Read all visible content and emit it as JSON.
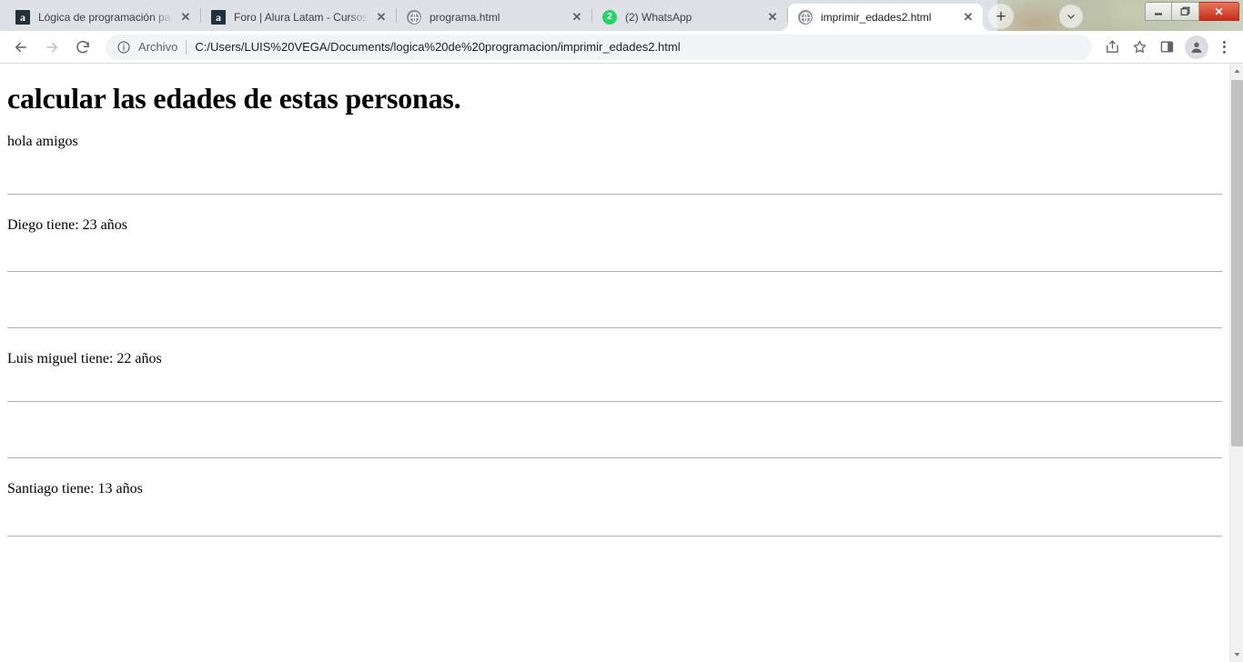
{
  "window": {
    "controls": {
      "minimize_label": "—",
      "maximize_label": "❐",
      "close_label": "✕"
    }
  },
  "tabstrip": {
    "tabs": [
      {
        "title": "Lógica de programación parte",
        "favicon": "alura-a-icon",
        "close_label": "✕",
        "active": false
      },
      {
        "title": "Foro | Alura Latam - Cursos on",
        "favicon": "alura-a-icon",
        "close_label": "✕",
        "active": false
      },
      {
        "title": "programa.html",
        "favicon": "globe-icon",
        "close_label": "✕",
        "active": false
      },
      {
        "title": "(2) WhatsApp",
        "favicon": "whatsapp-icon",
        "badge": "2",
        "close_label": "✕",
        "active": false
      },
      {
        "title": "imprimir_edades2.html",
        "favicon": "globe-icon",
        "close_label": "✕",
        "active": true
      }
    ],
    "new_tab_label": "+",
    "tab_search_label": "⌄"
  },
  "toolbar": {
    "back_label": "←",
    "forward_label": "→",
    "reload_label": "⟳",
    "omnibox": {
      "scheme_label": "Archivo",
      "url": "C:/Users/LUIS%20VEGA/Documents/logica%20de%20programacion/imprimir_edades2.html",
      "info_icon": "info-circle-icon"
    },
    "share_icon": "share-icon",
    "bookmark_icon": "star-icon",
    "side_panel_icon": "side-panel-icon",
    "profile_icon": "person-avatar-icon",
    "menu_icon": "three-dot-menu-icon"
  },
  "page": {
    "heading": "calcular las edades de estas personas.",
    "greeting": "hola amigos",
    "entries": [
      {
        "text": "Diego tiene: 23 años",
        "name": "Diego",
        "age": 23
      },
      {
        "text": "",
        "name": "",
        "age": null
      },
      {
        "text": "Luis miguel tiene: 22 años",
        "name": "Luis miguel",
        "age": 22
      },
      {
        "text": "",
        "name": "",
        "age": null
      },
      {
        "text": "Santiago tiene: 13 años",
        "name": "Santiago",
        "age": 13
      }
    ]
  },
  "scrollbar": {
    "up_arrow_label": "▲",
    "down_arrow_label": "▼"
  },
  "colors": {
    "tab_inactive_bg": "#dee1e6",
    "tab_active_bg": "#ffffff",
    "omnibox_bg": "#f1f3f4",
    "whatsapp_green": "#25d366",
    "alura_dark": "#22303b",
    "scrollbar_thumb": "#c1c1c1",
    "hr_color": "#b0b0b0",
    "close_button_red": "#c62d18"
  }
}
